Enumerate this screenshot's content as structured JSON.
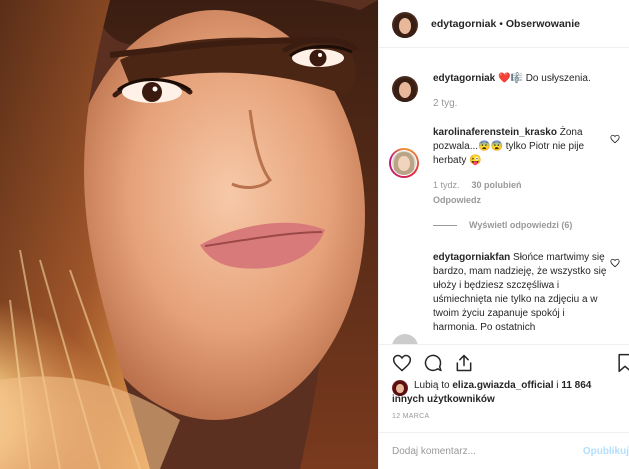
{
  "post": {
    "username": "edytagorniak",
    "separator": " • ",
    "follow_label": "Obserwowanie"
  },
  "caption": {
    "username": "edytagorniak",
    "text": " ❤️🎼 Do usłyszenia.",
    "time": "2 tyg."
  },
  "comments": [
    {
      "username": "karolinaferenstein_krasko",
      "text": " Żona pozwala...😨😨 tylko Piotr nie pije herbaty 😜",
      "time": "1 tydz.",
      "likes": "30 polubień",
      "reply_label": "Odpowiedz",
      "view_replies": "Wyświetl odpowiedzi (6)"
    },
    {
      "username": "edytagorniakfan",
      "text": " Słońce martwimy się bardzo, mam nadzieję, że wszystko się ułoży i będziesz szczęśliwa i uśmiechnięta nie tylko na zdjęciu a w twoim życiu zapanuje spokój i harmonia. Po ostatnich"
    }
  ],
  "likes": {
    "prefix": "Lubią to ",
    "user": "eliza.gwiazda_official",
    "middle": " i ",
    "others": "11 864 innych użytkowników"
  },
  "date": "12 MARCA",
  "comment_box": {
    "placeholder": "Dodaj komentarz...",
    "post_label": "Opublikuj"
  },
  "icons": {
    "like": "heart-icon",
    "comment": "comment-icon",
    "share": "share-icon",
    "save": "bookmark-icon"
  },
  "colors": {
    "text": "#262626",
    "muted": "#999999",
    "border": "#efefef",
    "post_disabled": "#b2dffc"
  }
}
